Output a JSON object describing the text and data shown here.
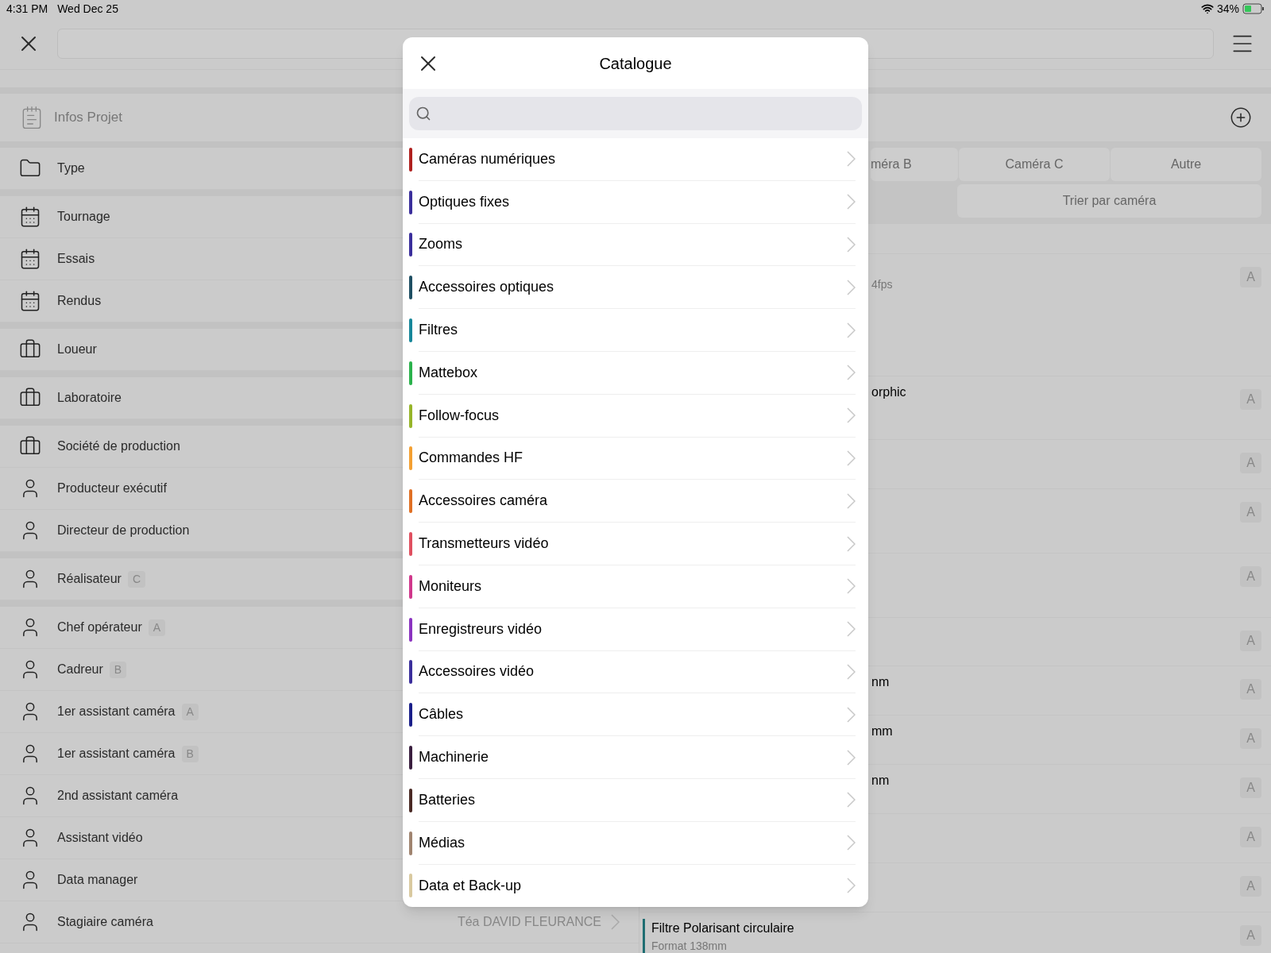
{
  "status_bar": {
    "time": "4:31 PM",
    "date": "Wed Dec 25",
    "battery": "34%"
  },
  "sidebar": {
    "header": "Infos Projet",
    "groups": [
      [
        {
          "kind": "folder",
          "label": "Type"
        }
      ],
      [
        {
          "kind": "date",
          "label": "Tournage"
        },
        {
          "kind": "date",
          "label": "Essais"
        },
        {
          "kind": "date",
          "label": "Rendus"
        }
      ],
      [
        {
          "kind": "company",
          "label": "Loueur"
        }
      ],
      [
        {
          "kind": "company",
          "label": "Laboratoire"
        }
      ],
      [
        {
          "kind": "company",
          "label": "Société de production"
        },
        {
          "kind": "person",
          "label": "Producteur exécutif"
        },
        {
          "kind": "person",
          "label": "Directeur de production"
        }
      ],
      [
        {
          "kind": "person",
          "label": "Réalisateur",
          "badge": "C"
        }
      ],
      [
        {
          "kind": "person",
          "label": "Chef opérateur",
          "badge": "A"
        },
        {
          "kind": "person",
          "label": "Cadreur",
          "badge": "B"
        },
        {
          "kind": "person",
          "label": "1er assistant caméra",
          "badge": "A"
        },
        {
          "kind": "person",
          "label": "1er assistant caméra",
          "badge": "B"
        },
        {
          "kind": "person",
          "label": "2nd assistant caméra"
        },
        {
          "kind": "person",
          "label": "Assistant vidéo"
        },
        {
          "kind": "person",
          "label": "Data manager"
        },
        {
          "kind": "person",
          "label": "Stagiaire caméra",
          "value": "Téa DAVID FLEURANCE"
        }
      ]
    ]
  },
  "equipment": {
    "tabs": [
      "méra B",
      "Caméra C",
      "Autre"
    ],
    "sort_button": "Trier par caméra",
    "rows": [
      {
        "subtitle": "4fps",
        "badge": "A"
      },
      {
        "title": "orphic",
        "badge": "A"
      },
      {
        "badge": "A"
      },
      {
        "badge": "A"
      },
      {
        "badge": "A"
      },
      {
        "badge": "A"
      },
      {
        "title": "nm",
        "badge": "A"
      },
      {
        "title": "mm",
        "badge": "A"
      },
      {
        "title": "nm",
        "badge": "A"
      },
      {
        "badge": "A"
      },
      {
        "badge": "A"
      },
      {
        "title": "Filtre Polarisant circulaire",
        "subtitle": "Format 138mm",
        "badge": "A",
        "color": "#1f6e72"
      }
    ]
  },
  "modal": {
    "title": "Catalogue",
    "categories": [
      {
        "label": "Caméras numériques",
        "color": "#b0211f"
      },
      {
        "label": "Optiques fixes",
        "color": "#3b2f9c"
      },
      {
        "label": "Zooms",
        "color": "#3b2f9c"
      },
      {
        "label": "Accessoires optiques",
        "color": "#1f4f63"
      },
      {
        "label": "Filtres",
        "color": "#17879a"
      },
      {
        "label": "Mattebox",
        "color": "#2bb24c"
      },
      {
        "label": "Follow-focus",
        "color": "#97b52a"
      },
      {
        "label": "Commandes HF",
        "color": "#f4a032"
      },
      {
        "label": "Accessoires caméra",
        "color": "#e07024"
      },
      {
        "label": "Transmetteurs vidéo",
        "color": "#e05060"
      },
      {
        "label": "Moniteurs",
        "color": "#d0388c"
      },
      {
        "label": "Enregistreurs vidéo",
        "color": "#8b33c0"
      },
      {
        "label": "Accessoires vidéo",
        "color": "#3b2f9c"
      },
      {
        "label": "Câbles",
        "color": "#1a1f8a"
      },
      {
        "label": "Machinerie",
        "color": "#3a1f3f"
      },
      {
        "label": "Batteries",
        "color": "#4a2a25"
      },
      {
        "label": "Médias",
        "color": "#a08470"
      },
      {
        "label": "Data et Back-up",
        "color": "#d9c9a0"
      }
    ]
  }
}
